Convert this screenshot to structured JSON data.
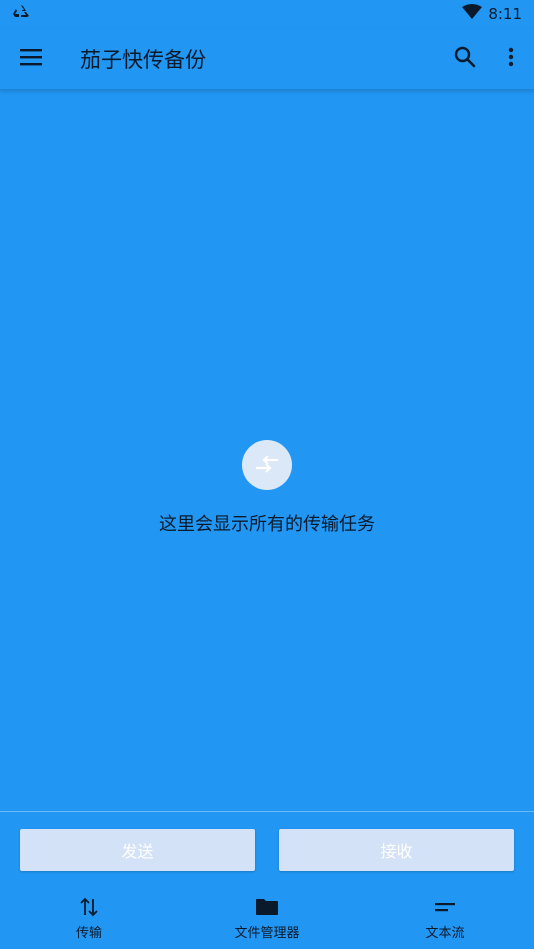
{
  "status_bar": {
    "time": "8:11",
    "icons": [
      "recycle-icon",
      "wifi-icon"
    ]
  },
  "app_bar": {
    "title": "茄子快传备份",
    "icons": [
      "menu-icon",
      "search-icon",
      "more-vert-icon"
    ]
  },
  "empty_state": {
    "icon": "transfer-icon",
    "message": "这里会显示所有的传输任务"
  },
  "actions": {
    "send_label": "发送",
    "receive_label": "接收"
  },
  "bottom_nav": {
    "items": [
      {
        "label": "传输",
        "icon": "transfer-arrows-icon"
      },
      {
        "label": "文件管理器",
        "icon": "folder-icon"
      },
      {
        "label": "文本流",
        "icon": "text-stream-icon"
      }
    ]
  },
  "colors": {
    "background": "#2196f3",
    "button_disabled": "#d3e2f7",
    "empty_icon_bg": "#dbe8f8",
    "text": "#0b1a2b"
  }
}
